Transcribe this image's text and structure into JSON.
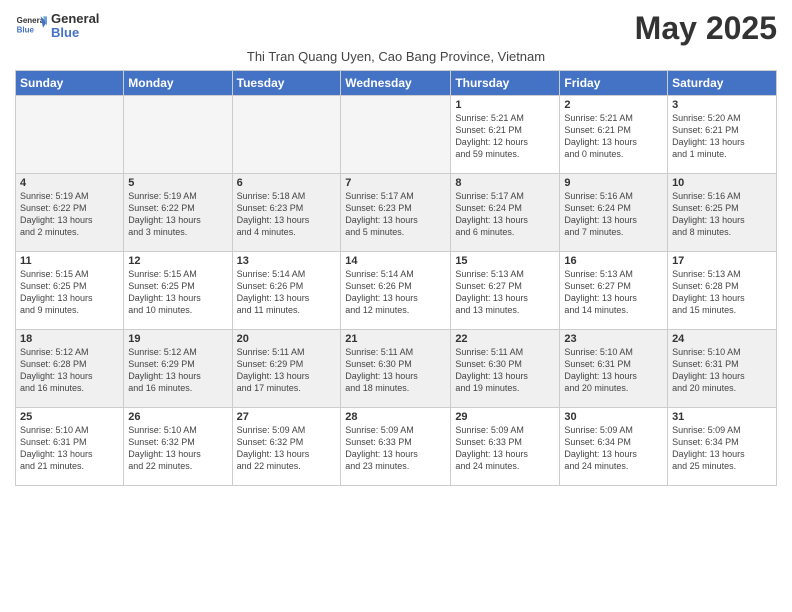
{
  "header": {
    "logo_general": "General",
    "logo_blue": "Blue",
    "month_title": "May 2025",
    "location": "Thi Tran Quang Uyen, Cao Bang Province, Vietnam"
  },
  "weekdays": [
    "Sunday",
    "Monday",
    "Tuesday",
    "Wednesday",
    "Thursday",
    "Friday",
    "Saturday"
  ],
  "rows": [
    [
      {
        "day": "",
        "info": "",
        "empty": true
      },
      {
        "day": "",
        "info": "",
        "empty": true
      },
      {
        "day": "",
        "info": "",
        "empty": true
      },
      {
        "day": "",
        "info": "",
        "empty": true
      },
      {
        "day": "1",
        "info": "Sunrise: 5:21 AM\nSunset: 6:21 PM\nDaylight: 12 hours\nand 59 minutes."
      },
      {
        "day": "2",
        "info": "Sunrise: 5:21 AM\nSunset: 6:21 PM\nDaylight: 13 hours\nand 0 minutes."
      },
      {
        "day": "3",
        "info": "Sunrise: 5:20 AM\nSunset: 6:21 PM\nDaylight: 13 hours\nand 1 minute."
      }
    ],
    [
      {
        "day": "4",
        "info": "Sunrise: 5:19 AM\nSunset: 6:22 PM\nDaylight: 13 hours\nand 2 minutes."
      },
      {
        "day": "5",
        "info": "Sunrise: 5:19 AM\nSunset: 6:22 PM\nDaylight: 13 hours\nand 3 minutes."
      },
      {
        "day": "6",
        "info": "Sunrise: 5:18 AM\nSunset: 6:23 PM\nDaylight: 13 hours\nand 4 minutes."
      },
      {
        "day": "7",
        "info": "Sunrise: 5:17 AM\nSunset: 6:23 PM\nDaylight: 13 hours\nand 5 minutes."
      },
      {
        "day": "8",
        "info": "Sunrise: 5:17 AM\nSunset: 6:24 PM\nDaylight: 13 hours\nand 6 minutes."
      },
      {
        "day": "9",
        "info": "Sunrise: 5:16 AM\nSunset: 6:24 PM\nDaylight: 13 hours\nand 7 minutes."
      },
      {
        "day": "10",
        "info": "Sunrise: 5:16 AM\nSunset: 6:25 PM\nDaylight: 13 hours\nand 8 minutes."
      }
    ],
    [
      {
        "day": "11",
        "info": "Sunrise: 5:15 AM\nSunset: 6:25 PM\nDaylight: 13 hours\nand 9 minutes."
      },
      {
        "day": "12",
        "info": "Sunrise: 5:15 AM\nSunset: 6:25 PM\nDaylight: 13 hours\nand 10 minutes."
      },
      {
        "day": "13",
        "info": "Sunrise: 5:14 AM\nSunset: 6:26 PM\nDaylight: 13 hours\nand 11 minutes."
      },
      {
        "day": "14",
        "info": "Sunrise: 5:14 AM\nSunset: 6:26 PM\nDaylight: 13 hours\nand 12 minutes."
      },
      {
        "day": "15",
        "info": "Sunrise: 5:13 AM\nSunset: 6:27 PM\nDaylight: 13 hours\nand 13 minutes."
      },
      {
        "day": "16",
        "info": "Sunrise: 5:13 AM\nSunset: 6:27 PM\nDaylight: 13 hours\nand 14 minutes."
      },
      {
        "day": "17",
        "info": "Sunrise: 5:13 AM\nSunset: 6:28 PM\nDaylight: 13 hours\nand 15 minutes."
      }
    ],
    [
      {
        "day": "18",
        "info": "Sunrise: 5:12 AM\nSunset: 6:28 PM\nDaylight: 13 hours\nand 16 minutes."
      },
      {
        "day": "19",
        "info": "Sunrise: 5:12 AM\nSunset: 6:29 PM\nDaylight: 13 hours\nand 16 minutes."
      },
      {
        "day": "20",
        "info": "Sunrise: 5:11 AM\nSunset: 6:29 PM\nDaylight: 13 hours\nand 17 minutes."
      },
      {
        "day": "21",
        "info": "Sunrise: 5:11 AM\nSunset: 6:30 PM\nDaylight: 13 hours\nand 18 minutes."
      },
      {
        "day": "22",
        "info": "Sunrise: 5:11 AM\nSunset: 6:30 PM\nDaylight: 13 hours\nand 19 minutes."
      },
      {
        "day": "23",
        "info": "Sunrise: 5:10 AM\nSunset: 6:31 PM\nDaylight: 13 hours\nand 20 minutes."
      },
      {
        "day": "24",
        "info": "Sunrise: 5:10 AM\nSunset: 6:31 PM\nDaylight: 13 hours\nand 20 minutes."
      }
    ],
    [
      {
        "day": "25",
        "info": "Sunrise: 5:10 AM\nSunset: 6:31 PM\nDaylight: 13 hours\nand 21 minutes."
      },
      {
        "day": "26",
        "info": "Sunrise: 5:10 AM\nSunset: 6:32 PM\nDaylight: 13 hours\nand 22 minutes."
      },
      {
        "day": "27",
        "info": "Sunrise: 5:09 AM\nSunset: 6:32 PM\nDaylight: 13 hours\nand 22 minutes."
      },
      {
        "day": "28",
        "info": "Sunrise: 5:09 AM\nSunset: 6:33 PM\nDaylight: 13 hours\nand 23 minutes."
      },
      {
        "day": "29",
        "info": "Sunrise: 5:09 AM\nSunset: 6:33 PM\nDaylight: 13 hours\nand 24 minutes."
      },
      {
        "day": "30",
        "info": "Sunrise: 5:09 AM\nSunset: 6:34 PM\nDaylight: 13 hours\nand 24 minutes."
      },
      {
        "day": "31",
        "info": "Sunrise: 5:09 AM\nSunset: 6:34 PM\nDaylight: 13 hours\nand 25 minutes."
      }
    ]
  ]
}
